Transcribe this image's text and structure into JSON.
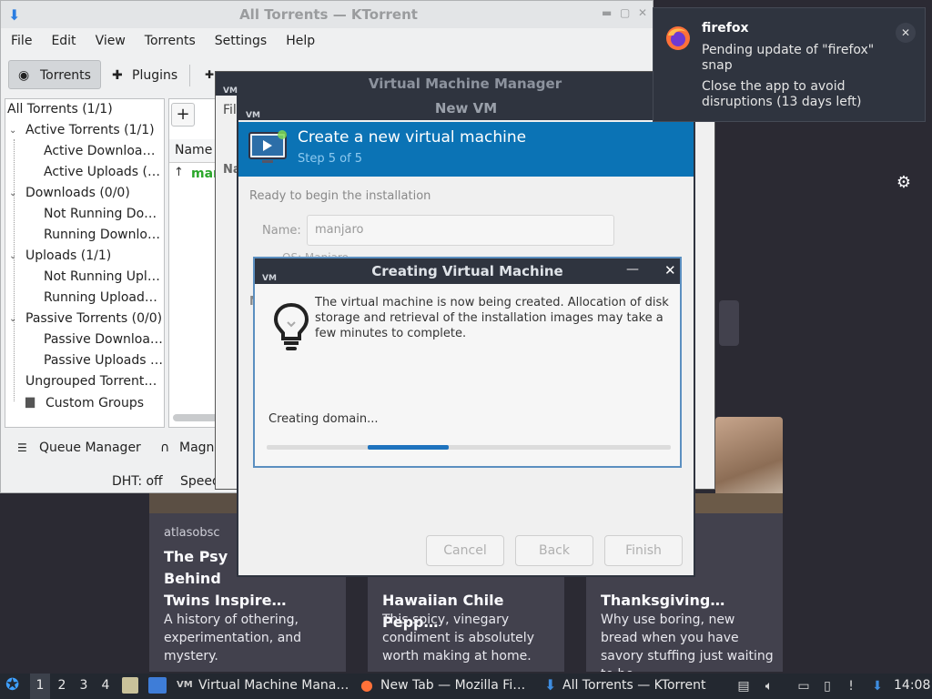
{
  "ktorrent": {
    "title": "All Torrents — KTorrent",
    "menu": [
      "File",
      "Edit",
      "View",
      "Torrents",
      "Settings",
      "Help"
    ],
    "toolbar": {
      "torrents": "Torrents",
      "plugins": "Plugins"
    },
    "groups": [
      "All Torrents (1/1)",
      "Active Torrents (1/1)",
      "Active Downloa…",
      "Active Uploads (…",
      "Downloads (0/0)",
      "Not Running Do…",
      "Running Downlo…",
      "Uploads (1/1)",
      "Not Running Upl…",
      "Running Upload…",
      "Passive Torrents (0/0)",
      "Passive Downloa…",
      "Passive Uploads …",
      "Ungrouped Torrent…",
      "Custom Groups"
    ],
    "column_name": "Name",
    "torrent_row": "man",
    "queue_manager": "Queue Manager",
    "magnet": "Magn",
    "dht": "DHT: off",
    "speed": "Speed"
  },
  "vmm": {
    "title": "Virtual Machine Manager",
    "menu_fragment": "Fil",
    "col_fragment": "Na"
  },
  "newvm": {
    "title": "New VM",
    "header_title": "Create a new virtual machine",
    "step": "Step 5 of 5",
    "ready": "Ready to begin the installation",
    "name_label": "Name:",
    "name_value": "manjaro",
    "os_label": "OS: Manjaro",
    "buttons": {
      "cancel": "Cancel",
      "back": "Back",
      "finish": "Finish"
    }
  },
  "dialog": {
    "title": "Creating Virtual Machine",
    "message": "The virtual machine is now being created. Allocation of disk storage and retrieval of the installation images may take a few minutes to complete.",
    "status": "Creating domain...",
    "progress_start": 0.25,
    "progress_width": 0.2
  },
  "notification": {
    "app": "firefox",
    "line1": "Pending update of \"firefox\" snap",
    "line2": "Close the app to avoid disruptions (13 days left)"
  },
  "firefox_cards": [
    {
      "source": "atlasobsc",
      "title": "The Psy\nBehind\nTwins Inspire…",
      "desc": "A history of othering, experimentation, and mystery."
    },
    {
      "source": "",
      "title": "Hawaiian Chile Pepp…",
      "desc": "This spicy, vinegary condiment is absolutely worth making at home."
    },
    {
      "source": "",
      "title": "Thanksgiving…",
      "desc": "Why use boring, new bread when you have savory stuffing just waiting to be…"
    }
  ],
  "taskbar": {
    "workspaces": [
      "1",
      "2",
      "3",
      "4"
    ],
    "windows": [
      "Virtual Machine Mana…",
      "New Tab — Mozilla Fi…",
      "All Torrents — KTorrent"
    ],
    "clock": "14:08"
  }
}
